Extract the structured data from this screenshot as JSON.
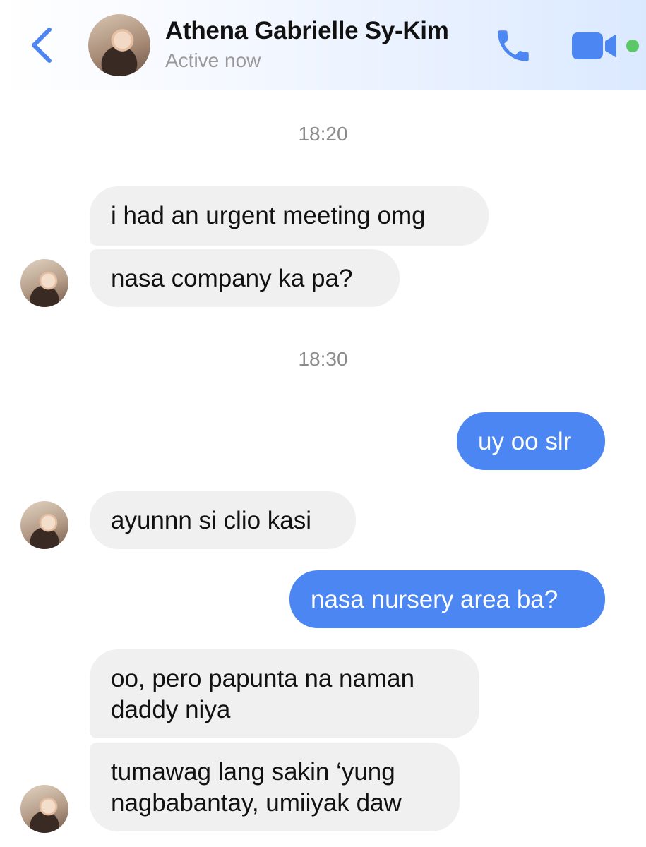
{
  "header": {
    "contact_name": "Athena Gabrielle Sy-Kim",
    "status": "Active now",
    "accent_color": "#4b86f2",
    "active_dot_color": "#5bc766",
    "icons": [
      "back-chevron-icon",
      "avatar",
      "phone-icon",
      "video-camera-icon"
    ]
  },
  "messages": {
    "ts1": "18:20",
    "m1": "i had an urgent meeting omg",
    "m2": "nasa company ka pa?",
    "ts2": "18:30",
    "m3": "uy oo slr",
    "m4": "ayunnn si clio kasi",
    "m5": "nasa nursery area ba?",
    "m6_line1": "oo, pero papunta na naman",
    "m6_line2": "daddy niya",
    "m7_line1": "tumawag lang sakin ‘yung",
    "m7_line2": "nagbabantay, umiiyak daw"
  }
}
